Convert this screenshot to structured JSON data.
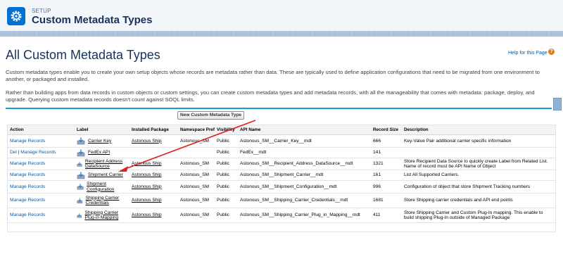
{
  "header": {
    "setup_label": "SETUP",
    "title": "Custom Metadata Types"
  },
  "page": {
    "title": "All Custom Metadata Types",
    "help_link": "Help for this Page",
    "paragraph1": "Custom metadata types enable you to create your own setup objects whose records are metadata rather than data. These are typically used to define application configurations that need to be migrated from one environment to another, or packaged and installed.",
    "paragraph2": "Rather than building apps from data records in custom objects or custom settings, you can create custom metadata types and add metadata records, with all the manageability that comes with metadata: package, deploy, and upgrade. Querying custom metadata records doesn't count against SOQL limits.",
    "new_button": "New Custom Metadata Type"
  },
  "table": {
    "headers": {
      "action": "Action",
      "label": "Label",
      "package": "Installed Package",
      "prefix": "Namespace Prefix",
      "visibility": "Visibility",
      "api": "API Name",
      "size": "Record Size",
      "description": "Description"
    },
    "rows": [
      {
        "action1": "Manage Records",
        "del": "",
        "sep": "",
        "label": "Carrier Key",
        "package": "Astonous Ship",
        "prefix": "Astonous_SM",
        "visibility": "Public",
        "api": "Astonous_SM__Carrier_Key__mdt",
        "size": "666",
        "description": "Key-Value Pair additional carrier specific information"
      },
      {
        "action1": "Manage Records",
        "del": "Del",
        "sep": " | ",
        "label": "FedEx API",
        "package": "",
        "prefix": "",
        "visibility": "Public",
        "api": "FedEx__mdt",
        "size": "141",
        "description": ""
      },
      {
        "action1": "Manage Records",
        "del": "",
        "sep": "",
        "label": "Recipient Address DataSource",
        "package": "Astonous Ship",
        "prefix": "Astonous_SM",
        "visibility": "Public",
        "api": "Astonous_SM__Recipient_Address_DataSource__mdt",
        "size": "1321",
        "description": "Store Recipient Data Source to quickly create Label from Related List. Name of record must be API Name of Object"
      },
      {
        "action1": "Manage Records",
        "del": "",
        "sep": "",
        "label": "Shipment Carrier",
        "package": "Astonous Ship",
        "prefix": "Astonous_SM",
        "visibility": "Public",
        "api": "Astonous_SM__Shipment_Carrier__mdt",
        "size": "161",
        "description": "List All Supported Carriers."
      },
      {
        "action1": "Manage Records",
        "del": "",
        "sep": "",
        "label": "Shipment Configuration",
        "package": "Astonous Ship",
        "prefix": "Astonous_SM",
        "visibility": "Public",
        "api": "Astonous_SM__Shipment_Configuration__mdt",
        "size": "996",
        "description": "Configuration of object that store Shipment Tracking numbers"
      },
      {
        "action1": "Manage Records",
        "del": "",
        "sep": "",
        "label": "Shipping Carrier Credentials",
        "package": "Astonous Ship",
        "prefix": "Astonous_SM",
        "visibility": "Public",
        "api": "Astonous_SM__Shipping_Carrier_Credentials__mdt",
        "size": "1681",
        "description": "Store Shipping carrier credentials and API end points"
      },
      {
        "action1": "Manage Records",
        "del": "",
        "sep": "",
        "label": "Shipping Carrier Plug-in Mapping",
        "package": "Astonous Ship",
        "prefix": "Astonous_SM",
        "visibility": "Public",
        "api": "Astonous_SM__Shipping_Carrier_Plug_in_Mapping__mdt",
        "size": "411",
        "description": "Store Shipping Carrier and Custom Plug-In mapping. This enable to build shipping Plug-In outside of Managed Package"
      }
    ]
  },
  "colors": {
    "accent": "#0070d2",
    "link": "#015ba7",
    "annotation_arrow": "#e02020"
  },
  "icons": {
    "setup": "gear-icon",
    "package": "package-install-icon",
    "help": "help-icon"
  }
}
